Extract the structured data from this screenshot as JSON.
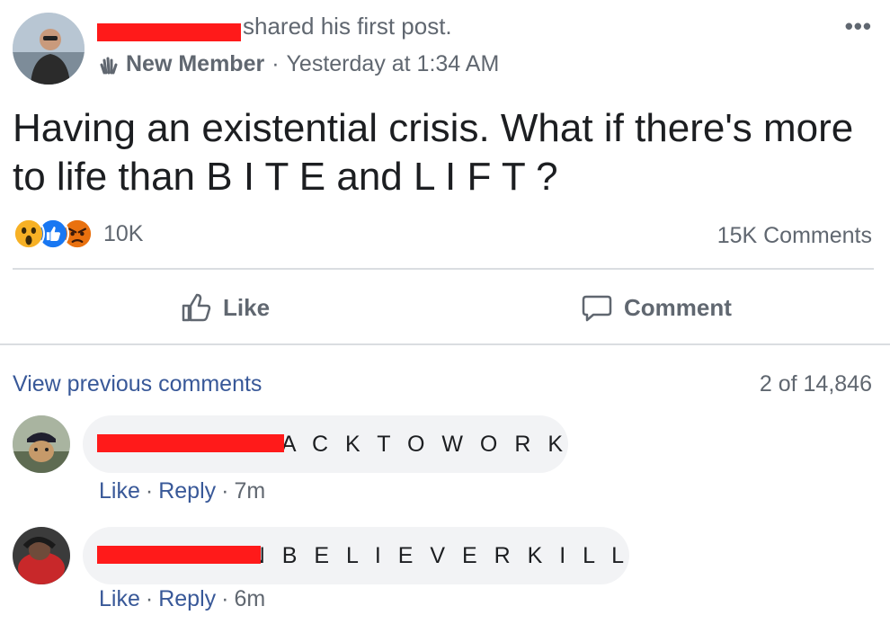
{
  "post": {
    "action_text": "shared his first post.",
    "badge": "New Member",
    "separator": "·",
    "timestamp": "Yesterday at 1:34 AM",
    "more_icon": "more-horizontal-icon",
    "body": "Having an existential crisis. What if there's more to life than B I T E and L I F T ?",
    "reactions": [
      "wow-icon",
      "like-icon",
      "angry-icon"
    ],
    "reaction_count": "10K",
    "comment_count": "15K Comments",
    "like_label": "Like",
    "comment_label": "Comment"
  },
  "comments_section": {
    "view_previous": "View previous comments",
    "pager": "2 of 14,846",
    "items": [
      {
        "text": "B A C K T O W O R K",
        "like": "Like",
        "dot": "·",
        "reply": "Reply",
        "time": "7m"
      },
      {
        "text": "N O N B E L I E V E R K I L L",
        "like": "Like",
        "dot": "·",
        "reply": "Reply",
        "time": "6m"
      }
    ]
  },
  "colors": {
    "link": "#385898",
    "muted": "#606770",
    "bubble": "#f2f3f5",
    "redaction": "#ff1a1a",
    "divider": "#dadde1"
  }
}
